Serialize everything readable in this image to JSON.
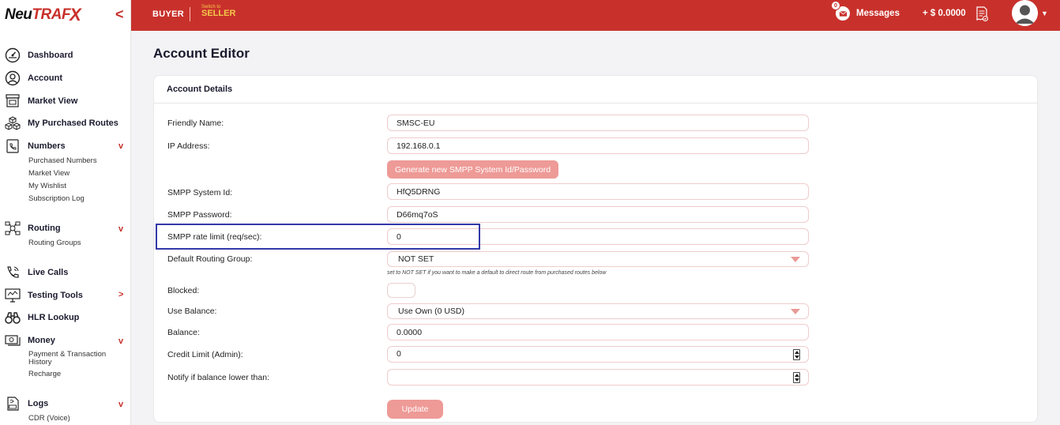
{
  "brand": {
    "name_prefix": "Neu",
    "name_suffix": "TRAF",
    "name_x": "X",
    "collapse_icon": "<"
  },
  "topbar": {
    "buyer_label": "BUYER",
    "switch_small": "Switch to",
    "switch_big": "SELLER",
    "messages_label": "Messages",
    "messages_count": "0",
    "balance": "+ $ 0.0000"
  },
  "sidebar": {
    "items": [
      {
        "label": "Dashboard"
      },
      {
        "label": "Account"
      },
      {
        "label": "Market View"
      },
      {
        "label": "My Purchased Routes"
      },
      {
        "label": "Numbers",
        "chevron": "v"
      },
      {
        "label": "Routing",
        "chevron": "v"
      },
      {
        "label": "Live Calls"
      },
      {
        "label": "Testing Tools",
        "chevron": ">"
      },
      {
        "label": "HLR Lookup"
      },
      {
        "label": "Money",
        "chevron": "v"
      },
      {
        "label": "Logs",
        "chevron": "v"
      }
    ],
    "numbers_sub": [
      "Purchased Numbers",
      "Market View",
      "My Wishlist",
      "Subscription Log"
    ],
    "routing_sub": [
      "Routing Groups"
    ],
    "money_sub": [
      "Payment & Transaction History",
      "Recharge"
    ],
    "logs_sub": [
      "CDR (Voice)"
    ]
  },
  "page": {
    "title": "Account Editor",
    "card_title": "Account Details"
  },
  "form": {
    "friendly_name": {
      "label": "Friendly Name:",
      "value": "SMSC-EU"
    },
    "ip_address": {
      "label": "IP Address:",
      "value": "192.168.0.1"
    },
    "generate_button": "Generate new SMPP System Id/Password",
    "system_id": {
      "label": "SMPP System Id:",
      "value": "HfQ5DRNG"
    },
    "password": {
      "label": "SMPP Password:",
      "value": "D66mq7oS"
    },
    "rate_limit": {
      "label": "SMPP rate limit (req/sec):",
      "value": "0"
    },
    "routing_group": {
      "label": "Default Routing Group:",
      "value": "NOT SET"
    },
    "routing_hint": "set to NOT SET if you want to make a default to direct route from purchased routes below",
    "blocked": {
      "label": "Blocked:"
    },
    "use_balance": {
      "label": "Use Balance:",
      "value": "Use Own (0 USD)"
    },
    "balance": {
      "label": "Balance:",
      "value": "0.0000"
    },
    "credit_limit": {
      "label": "Credit Limit (Admin):",
      "value": "0"
    },
    "notify_lower": {
      "label": "Notify if balance lower than:",
      "value": ""
    },
    "update_button": "Update"
  },
  "colors": {
    "brand_red": "#c8312b",
    "button_pink": "#ee9a97",
    "highlight": "#3338a8",
    "seller_gold": "#f4c84a"
  }
}
